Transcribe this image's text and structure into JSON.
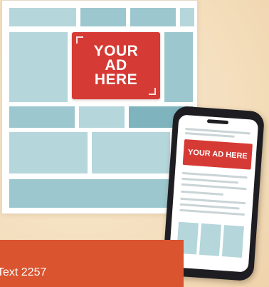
{
  "desktop_ad": {
    "label": "YOUR AD HERE"
  },
  "mobile_ad": {
    "label": "YOUR AD HERE"
  },
  "footer": {
    "text": "Text 2257"
  },
  "colors": {
    "ad_red": "#d63a34",
    "footer_orange": "#d9542f",
    "block_teal": "#b5d6db",
    "background": "#f6e4c6"
  }
}
